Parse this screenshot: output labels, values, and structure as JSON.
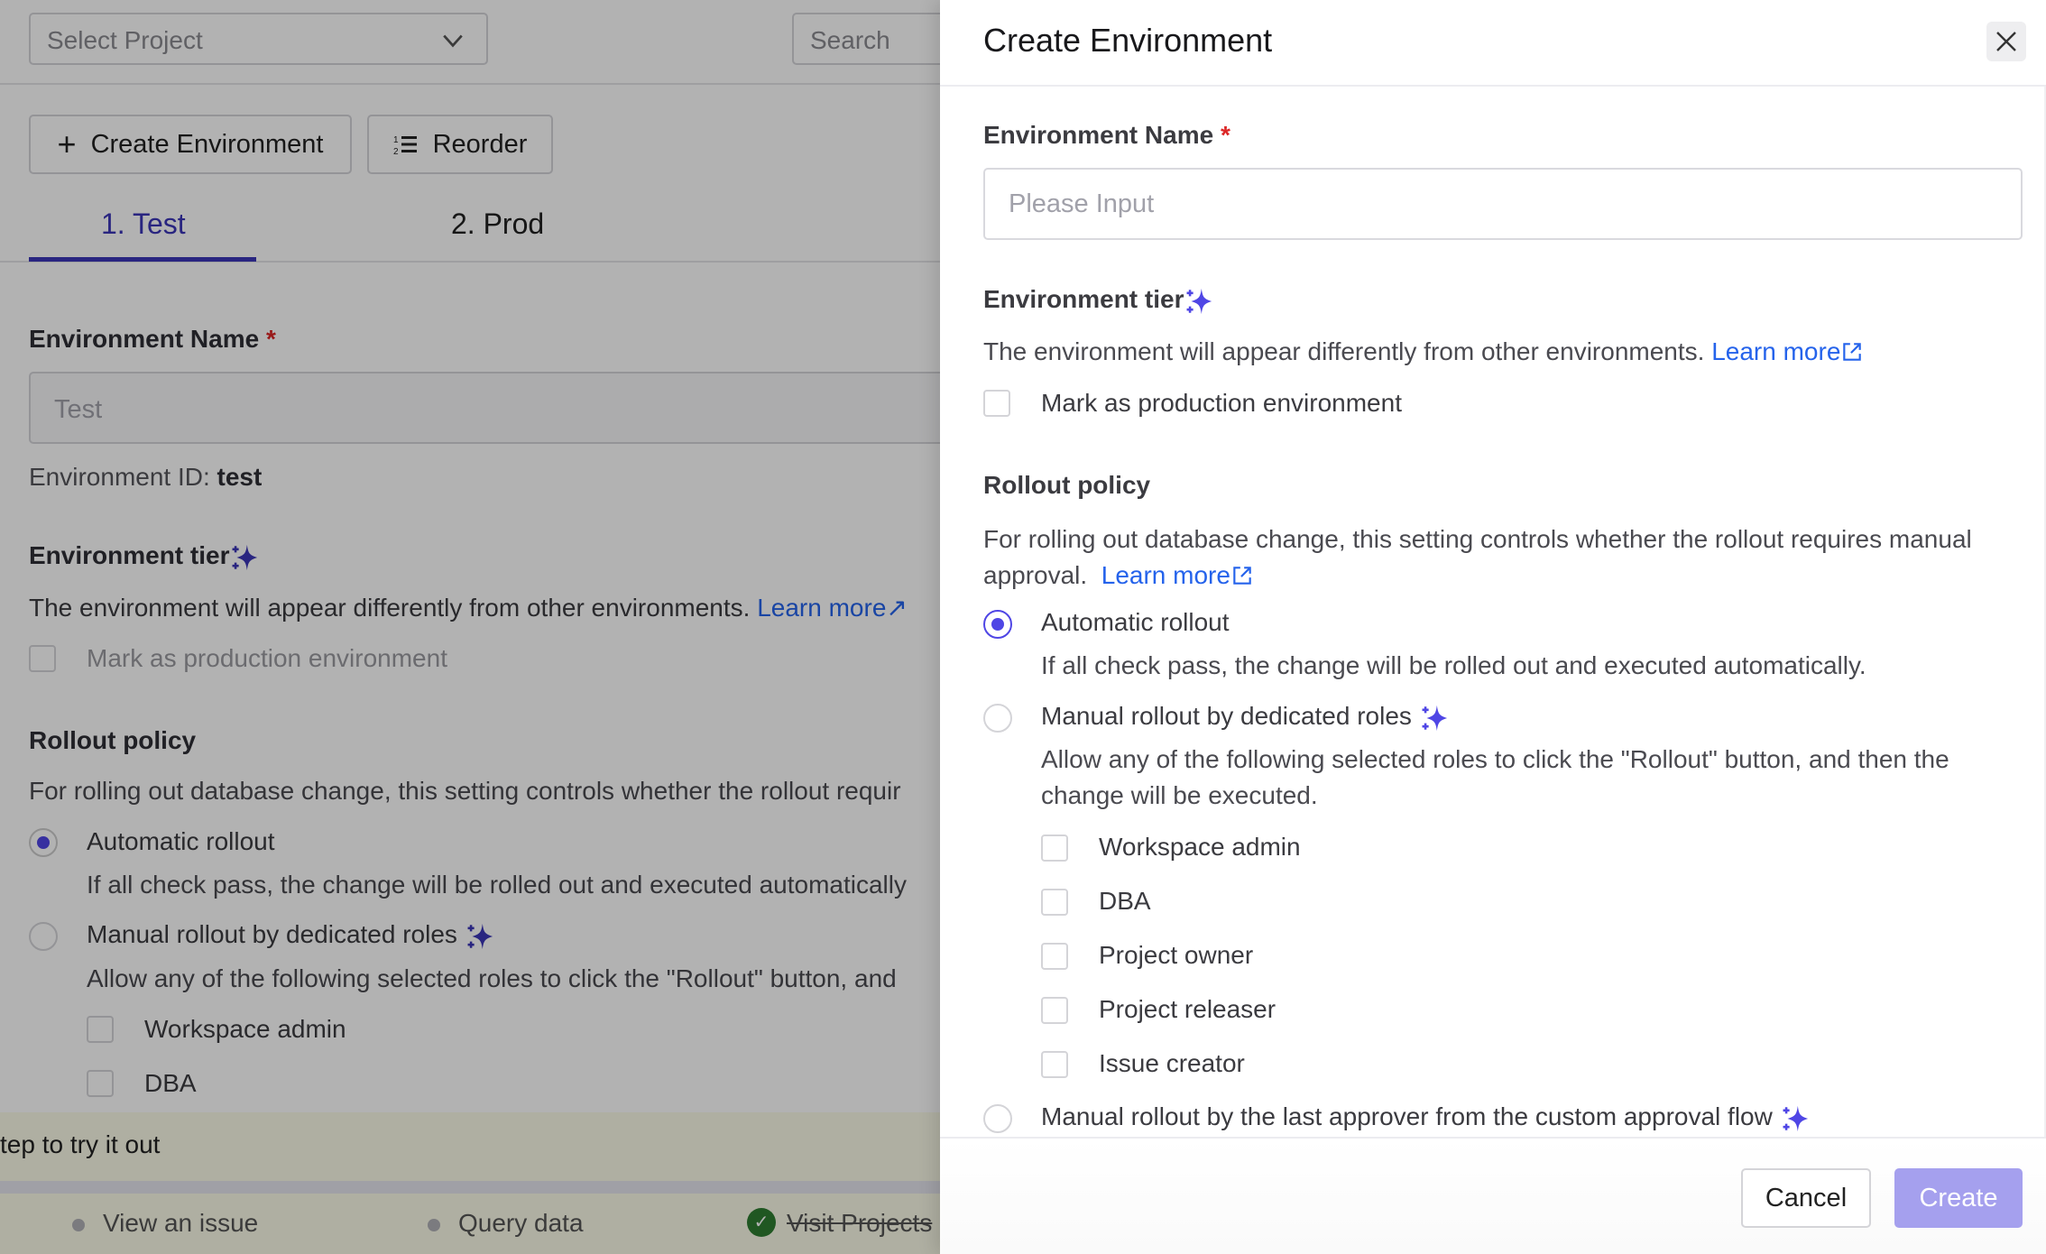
{
  "background_page": {
    "project_select": {
      "placeholder": "Select Project"
    },
    "search": {
      "placeholder": "Search"
    },
    "toolbar": {
      "create_label": "Create Environment",
      "reorder_label": "Reorder"
    },
    "tabs": [
      {
        "label": "1. Test",
        "active": true
      },
      {
        "label": "2. Prod",
        "active": false
      }
    ],
    "form": {
      "name_label": "Environment Name",
      "required_mark": "*",
      "name_value": "Test",
      "id_label": "Environment ID:",
      "id_value": "test",
      "tier_label": "Environment tier",
      "tier_desc": "The environment will appear differently from other environments.",
      "learn_more": "Learn more",
      "production_checkbox": "Mark as production environment",
      "rollout_label": "Rollout policy",
      "rollout_desc": "For rolling out database change, this setting controls whether the rollout requir",
      "auto_label": "Automatic rollout",
      "auto_desc": "If all check pass, the change will be rolled out and executed automatically",
      "manual_label": "Manual rollout by dedicated roles",
      "manual_desc": "Allow any of the following selected roles to click the \"Rollout\" button, and",
      "roles": [
        "Workspace admin",
        "DBA"
      ]
    },
    "onboarding": {
      "banner_text": "tep to try it out",
      "steps": [
        {
          "label": "View an issue",
          "done": false
        },
        {
          "label": "Query data",
          "done": false
        },
        {
          "label": "Visit Projects",
          "done": true
        }
      ]
    }
  },
  "drawer": {
    "title": "Create Environment",
    "name_label": "Environment Name",
    "required_mark": "*",
    "name_placeholder": "Please Input",
    "name_value": "",
    "tier_label": "Environment tier",
    "tier_desc": "The environment will appear differently from other environments.",
    "learn_more": "Learn more",
    "production_checkbox": "Mark as production environment",
    "production_checked": false,
    "rollout_label": "Rollout policy",
    "rollout_desc": "For rolling out database change, this setting controls whether the rollout requires manual approval.",
    "rollout_options": [
      {
        "label": "Automatic rollout",
        "desc": "If all check pass, the change will be rolled out and executed automatically.",
        "selected": true
      },
      {
        "label": "Manual rollout by dedicated roles",
        "desc": "Allow any of the following selected roles to click the \"Rollout\" button, and then the change will be executed.",
        "selected": false
      },
      {
        "label": "Manual rollout by the last approver from the custom approval flow",
        "selected": false
      }
    ],
    "roles": [
      "Workspace admin",
      "DBA",
      "Project owner",
      "Project releaser",
      "Issue creator"
    ],
    "cancel_label": "Cancel",
    "create_label": "Create"
  },
  "colors": {
    "accent": "#4f46e5",
    "link": "#2563eb",
    "required": "#dc2626",
    "create_disabled": "#a5a0ee",
    "done": "#2e7d32"
  }
}
